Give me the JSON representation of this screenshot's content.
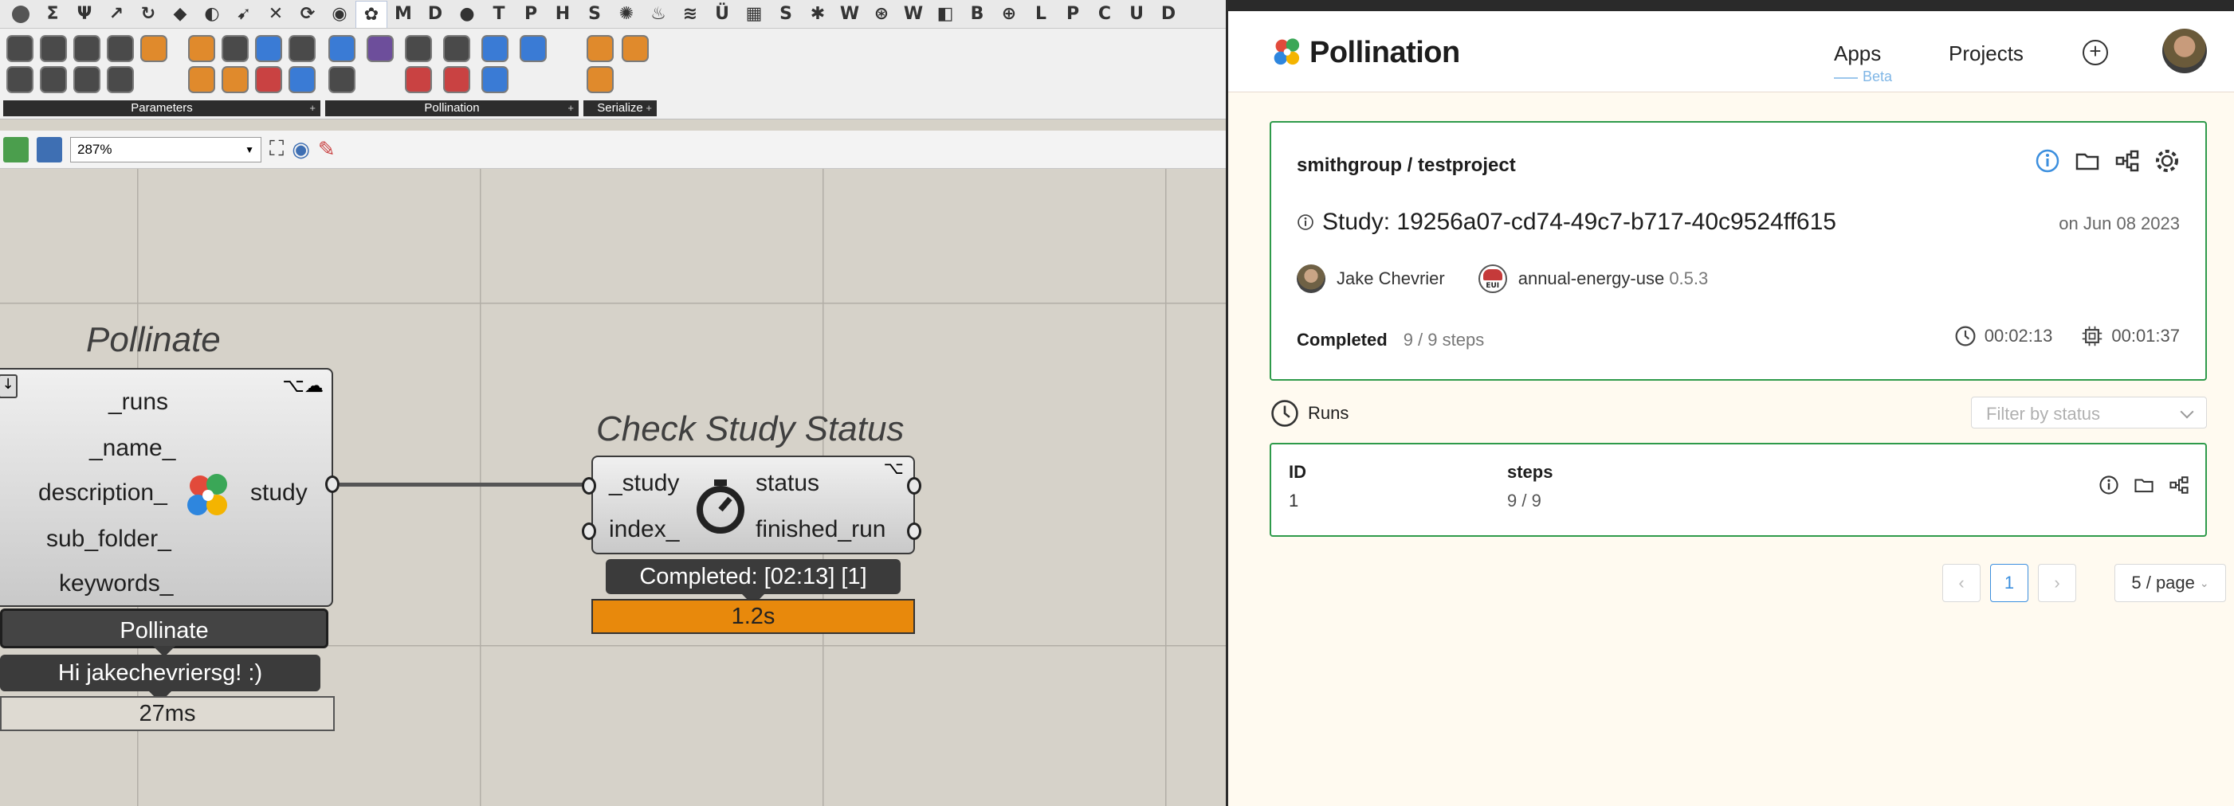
{
  "grasshopper": {
    "tabs": [
      "M",
      "D",
      "T",
      "P",
      "H",
      "S",
      "W",
      "W",
      "B",
      "L",
      "P",
      "C",
      "U",
      "D"
    ],
    "panels": {
      "parameters": "Parameters",
      "pollination": "Pollination",
      "serialize": "Serialize"
    },
    "zoom": "287%",
    "pollinate_node": {
      "title": "Pollinate",
      "inputs": [
        "_runs",
        "_name_",
        "description_",
        "sub_folder_",
        "keywords_"
      ],
      "output": "study",
      "button_label": "Pollinate",
      "message": "Hi jakechevriersg! :)",
      "timing": "27ms"
    },
    "check_status_node": {
      "title": "Check Study Status",
      "inputs": [
        "_study",
        "index_"
      ],
      "outputs": [
        "status",
        "finished_run"
      ],
      "message": "Completed: [02:13] [1]",
      "timing": "1.2s"
    },
    "colors": {
      "canvas": "#d6d2c9",
      "timing_warn": "#e8890c"
    }
  },
  "pollination": {
    "brand": "Pollination",
    "nav": {
      "apps": "Apps",
      "beta": "Beta",
      "projects": "Projects"
    },
    "study": {
      "owner_project": "smithgroup / testproject",
      "title": "Study: 19256a07-cd74-49c7-b717-40c9524ff615",
      "date": "on Jun 08 2023",
      "author": "Jake Chevrier",
      "recipe": "annual-energy-use",
      "recipe_version": "0.5.3",
      "status": "Completed",
      "steps": "9 / 9 steps",
      "duration": "00:02:13",
      "compute_time": "00:01:37"
    },
    "runs": {
      "label": "Runs",
      "filter_placeholder": "Filter by status",
      "columns": [
        "ID",
        "steps"
      ],
      "rows": [
        {
          "id": "1",
          "steps": "9 / 9"
        }
      ]
    },
    "pagination": {
      "current": "1",
      "page_size": "5 / page"
    },
    "colors": {
      "accent_green": "#2e9a4a",
      "accent_blue": "#3c8fde",
      "background": "#fffaf0"
    }
  }
}
